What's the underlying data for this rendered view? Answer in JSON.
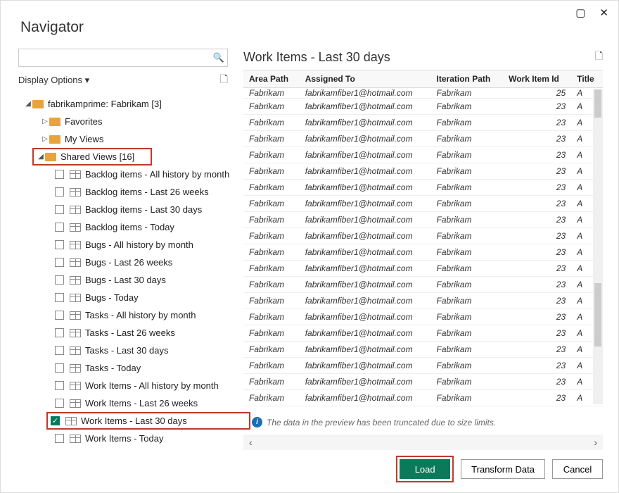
{
  "window": {
    "title": "Navigator"
  },
  "tree_header": {
    "label": "Display Options"
  },
  "search": {
    "placeholder": ""
  },
  "root": {
    "label": "fabrikamprime: Fabrikam [3]"
  },
  "favorites": {
    "label": "Favorites"
  },
  "myviews": {
    "label": "My Views"
  },
  "shared": {
    "label": "Shared Views [16]"
  },
  "items": [
    "Backlog items - All history by month",
    "Backlog items - Last 26 weeks",
    "Backlog items - Last 30 days",
    "Backlog items - Today",
    "Bugs - All history by month",
    "Bugs - Last 26 weeks",
    "Bugs - Last 30 days",
    "Bugs - Today",
    "Tasks - All history by month",
    "Tasks - Last 26 weeks",
    "Tasks - Last 30 days",
    "Tasks - Today",
    "Work Items - All history by month",
    "Work Items - Last 26 weeks",
    "Work Items - Last 30 days",
    "Work Items - Today"
  ],
  "selected_index": 14,
  "preview": {
    "title": "Work Items - Last 30 days",
    "columns": [
      "Area Path",
      "Assigned To",
      "Iteration Path",
      "Work Item Id",
      "Title"
    ],
    "rows_top": {
      "area": "Fabrikam",
      "assigned": "fabrikamfiber1@hotmail.com",
      "iter": "Fabrikam",
      "id": "25",
      "title": "A"
    },
    "row": {
      "area": "Fabrikam",
      "assigned": "fabrikamfiber1@hotmail.com",
      "iter": "Fabrikam",
      "id": "23",
      "title": "A"
    },
    "row_count": 19,
    "truncated_msg": "The data in the preview has been truncated due to size limits."
  },
  "footer": {
    "load": "Load",
    "transform": "Transform Data",
    "cancel": "Cancel"
  }
}
